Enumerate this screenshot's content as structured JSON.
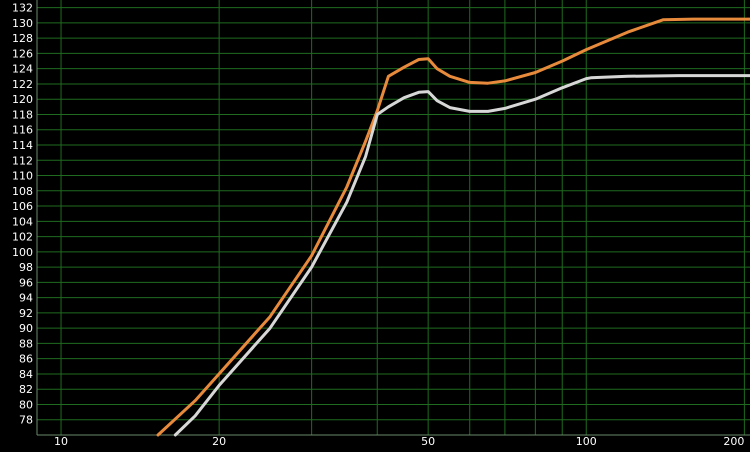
{
  "chart_data": {
    "type": "line",
    "x_scale": "log",
    "xlim": [
      9,
      205
    ],
    "ylim": [
      76,
      133
    ],
    "grid": true,
    "y_ticks": [
      78,
      80,
      82,
      84,
      86,
      88,
      90,
      92,
      94,
      96,
      98,
      100,
      102,
      104,
      106,
      108,
      110,
      112,
      114,
      116,
      118,
      120,
      122,
      124,
      126,
      128,
      130,
      132
    ],
    "x_gridlines": [
      10,
      20,
      30,
      40,
      50,
      60,
      70,
      80,
      90,
      100,
      200
    ],
    "x_tick_labels": [
      {
        "value": 10,
        "label": "10"
      },
      {
        "value": 20,
        "label": "20"
      },
      {
        "value": 50,
        "label": "50"
      },
      {
        "value": 100,
        "label": "100"
      },
      {
        "value": 200,
        "label": "200"
      }
    ],
    "series": [
      {
        "color": "#e88a3c",
        "x": [
          15.3,
          18,
          20,
          25,
          30,
          35,
          38,
          40,
          42,
          45,
          48,
          50,
          52,
          55,
          60,
          65,
          70,
          80,
          90,
          100,
          120,
          140,
          160,
          200,
          205
        ],
        "y": [
          76,
          80.5,
          84,
          91.5,
          99.5,
          108.5,
          114.5,
          118.5,
          123,
          124.2,
          125.2,
          125.3,
          124,
          123,
          122.2,
          122.1,
          122.4,
          123.5,
          125,
          126.5,
          128.8,
          130.4,
          130.5,
          130.5,
          130.5
        ]
      },
      {
        "color": "#d7d7d7",
        "x": [
          16.5,
          18,
          20,
          25,
          30,
          35,
          38,
          40,
          42,
          45,
          48,
          50,
          52,
          55,
          60,
          65,
          70,
          80,
          90,
          100,
          102,
          120,
          150,
          200,
          205
        ],
        "y": [
          76,
          78.5,
          82.5,
          90,
          98,
          106.5,
          112.5,
          118,
          119,
          120.2,
          120.9,
          121,
          119.8,
          118.9,
          118.4,
          118.4,
          118.8,
          120,
          121.5,
          122.7,
          122.8,
          123,
          123.1,
          123.1,
          123.1
        ]
      }
    ]
  }
}
